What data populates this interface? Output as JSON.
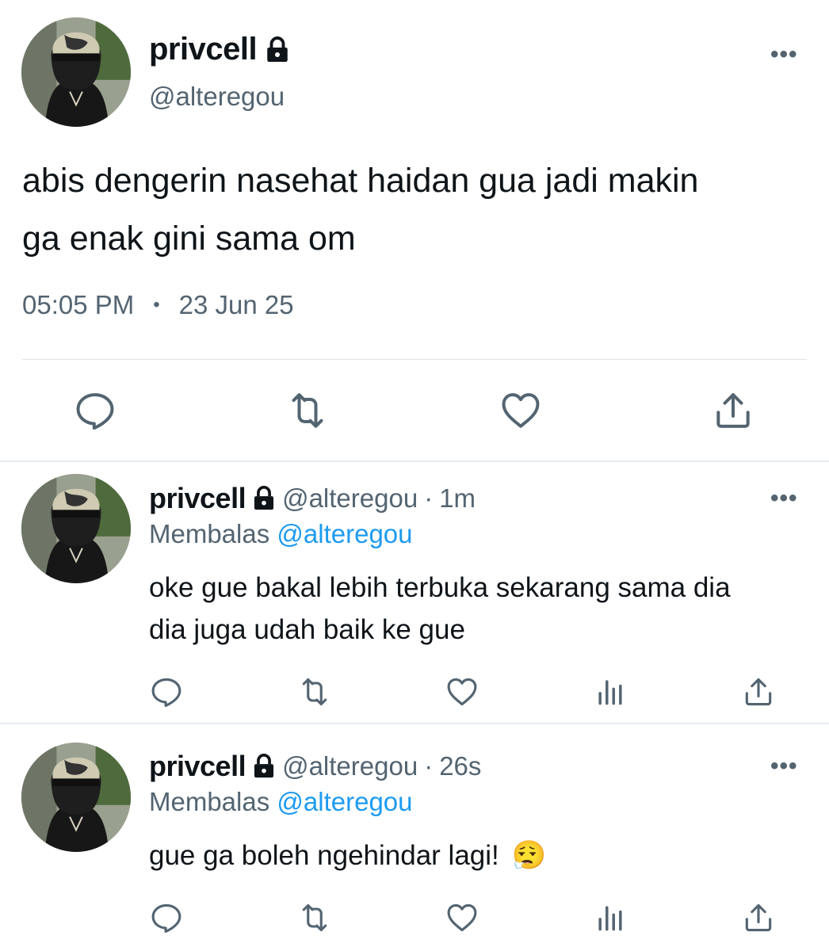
{
  "main_tweet": {
    "display_name": "privcell",
    "handle": "@alteregou",
    "text_line1": "abis dengerin nasehat haidan gua jadi makin",
    "text_line2": "ga enak gini sama om",
    "time": "05:05 PM",
    "separator": "•",
    "date": "23 Jun 25",
    "more": "•••"
  },
  "replies": [
    {
      "display_name": "privcell",
      "handle": "@alteregou",
      "meta_sep": "·",
      "age": "1m",
      "replying_label": "Membalas",
      "replying_to": "@alteregou",
      "text_line1": "oke gue bakal lebih terbuka sekarang sama dia",
      "text_line2": "dia juga udah baik ke gue",
      "more": "•••"
    },
    {
      "display_name": "privcell",
      "handle": "@alteregou",
      "meta_sep": "·",
      "age": "26s",
      "replying_label": "Membalas",
      "replying_to": "@alteregou",
      "text_line1": "gue ga boleh ngehindar lagi!",
      "emoji": "😮‍💨",
      "more": "•••"
    }
  ],
  "icons": {
    "lock": "lock-icon",
    "reply": "reply-icon",
    "retweet": "retweet-icon",
    "like": "heart-icon",
    "share": "share-icon",
    "analytics": "analytics-icon"
  },
  "colors": {
    "text": "#0f1419",
    "secondary": "#536471",
    "accent": "#1d9bf0",
    "divider": "#e6ecf0"
  }
}
